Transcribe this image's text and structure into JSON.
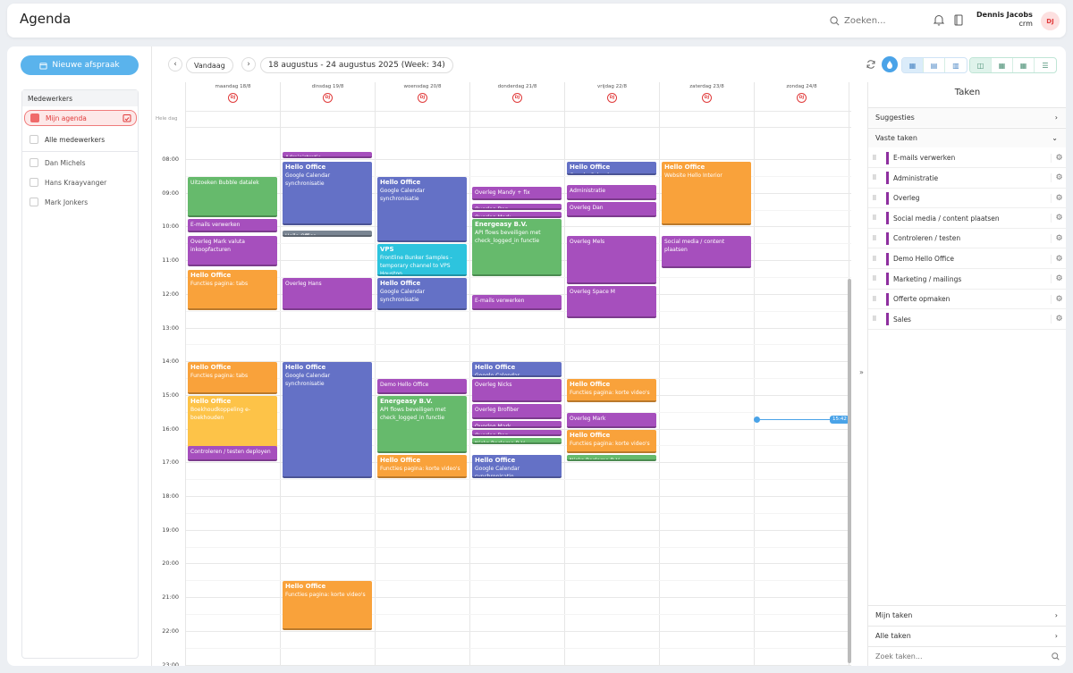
{
  "app": {
    "title": "Agenda"
  },
  "search": {
    "placeholder": "Zoeken..."
  },
  "user": {
    "name": "Dennis Jacobs",
    "role": "crm",
    "initials": "DJ"
  },
  "sidebar": {
    "new_button": "Nieuwe afspraak",
    "section_title": "Medewerkers",
    "items": [
      {
        "label": "Mijn agenda"
      },
      {
        "label": "Alle medewerkers"
      },
      {
        "label": "Dan Michels"
      },
      {
        "label": "Hans Kraayvanger"
      },
      {
        "label": "Mark Jonkers"
      }
    ]
  },
  "toolbar": {
    "prev": "‹",
    "next": "›",
    "today": "Vandaag",
    "range": "18 augustus - 24 augustus 2025 (Week: 34)"
  },
  "days": [
    {
      "label": "maandag 18/8",
      "initials": "DJ"
    },
    {
      "label": "dinsdag 19/8",
      "initials": "DJ"
    },
    {
      "label": "woensdag 20/8",
      "initials": "DJ"
    },
    {
      "label": "donderdag 21/8",
      "initials": "DJ"
    },
    {
      "label": "vrijdag 22/8",
      "initials": "DJ"
    },
    {
      "label": "zaterdag 23/8",
      "initials": "DJ"
    },
    {
      "label": "zondag 24/8",
      "initials": "DJ"
    }
  ],
  "allday_label": "Hele dag",
  "hours": [
    "08:00",
    "09:00",
    "10:00",
    "11:00",
    "12:00",
    "13:00",
    "14:00",
    "15:00",
    "16:00",
    "17:00",
    "18:00",
    "19:00",
    "20:00",
    "21:00",
    "22:00",
    "23:00"
  ],
  "now_label": "15:42",
  "events": [
    {
      "title": "",
      "text": "Administratie",
      "color": "purple"
    },
    {
      "title": "Hello Office",
      "text": "Google Calendar synchronisatie",
      "color": "blue"
    },
    {
      "title": "",
      "text": "Hello Office",
      "color": "grey"
    },
    {
      "title": "",
      "text": "Uitzoeken Bubble datalek",
      "color": "green"
    },
    {
      "title": "",
      "text": "E-mails verwerken",
      "color": "purple"
    },
    {
      "title": "",
      "text": "Overleg Mark valuta inkoopfacturen",
      "color": "purple"
    },
    {
      "title": "Hello Office",
      "text": "Functies pagina: tabs",
      "color": "orange"
    },
    {
      "title": "",
      "text": "Overleg Hans",
      "color": "purple"
    },
    {
      "title": "Hello Office",
      "text": "Google Calendar synchronisatie",
      "color": "blue"
    },
    {
      "title": "VPS",
      "text": "Frontline Bunker Samples - temporary channel to VPS Houston",
      "color": "teal"
    },
    {
      "title": "Hello Office",
      "text": "Google Calendar synchronisatie",
      "color": "blue"
    },
    {
      "title": "",
      "text": "Overleg Mandy + fix",
      "color": "purple"
    },
    {
      "title": "",
      "text": "Overleg Dan",
      "color": "purple"
    },
    {
      "title": "",
      "text": "Overleg Mark",
      "color": "purple"
    },
    {
      "title": "Energeasy B.V.",
      "text": "API flows beveiligen met check_logged_in functie",
      "color": "green"
    },
    {
      "title": "",
      "text": "E-mails verwerken",
      "color": "purple"
    },
    {
      "title": "Hello Office",
      "text": "Google Calendar",
      "color": "blue"
    },
    {
      "title": "",
      "text": "Administratie",
      "color": "purple"
    },
    {
      "title": "",
      "text": "Overleg Dan",
      "color": "purple"
    },
    {
      "title": "",
      "text": "Overleg Mels",
      "color": "purple"
    },
    {
      "title": "",
      "text": "Overleg Space M",
      "color": "purple"
    },
    {
      "title": "Hello Office",
      "text": "Website Hello Interior",
      "color": "orange"
    },
    {
      "title": "",
      "text": "Social media / content plaatsen",
      "color": "purple"
    },
    {
      "title": "Hello Office",
      "text": "Functies pagina: tabs",
      "color": "orange"
    },
    {
      "title": "Hello Office",
      "text": "Boekhoudkoppeling e-boekhouden",
      "color": "yellow"
    },
    {
      "title": "",
      "text": "Controleren / testen deployen",
      "color": "purple"
    },
    {
      "title": "Hello Office",
      "text": "Google Calendar synchronisatie",
      "color": "blue"
    },
    {
      "title": "",
      "text": "Demo Hello Office",
      "color": "purple"
    },
    {
      "title": "Energeasy B.V.",
      "text": "API flows beveiligen met check_logged_in functie",
      "color": "green"
    },
    {
      "title": "Hello Office",
      "text": "Functies pagina: korte video's",
      "color": "orange"
    },
    {
      "title": "Hello Office",
      "text": "Google Calendar",
      "color": "blue"
    },
    {
      "title": "",
      "text": "Overleg Nicks",
      "color": "purple"
    },
    {
      "title": "",
      "text": "Overleg Brofiber",
      "color": "purple"
    },
    {
      "title": "",
      "text": "Overleg Mark",
      "color": "purple"
    },
    {
      "title": "",
      "text": "Overleg Dan",
      "color": "purple"
    },
    {
      "title": "",
      "text": "Nicks Reclame B.V.",
      "color": "green"
    },
    {
      "title": "Hello Office",
      "text": "Google Calendar synchronisatie",
      "color": "blue"
    },
    {
      "title": "Hello Office",
      "text": "Functies pagina: korte video's",
      "color": "orange"
    },
    {
      "title": "",
      "text": "Overleg Mark",
      "color": "purple"
    },
    {
      "title": "Hello Office",
      "text": "Functies pagina: korte video's",
      "color": "orange"
    },
    {
      "title": "",
      "text": "Nicks Reclame B.V.",
      "color": "green"
    },
    {
      "title": "Hello Office",
      "text": "Functies pagina: korte video's",
      "color": "orange"
    }
  ],
  "taken": {
    "title": "Taken",
    "suggesties": "Suggesties",
    "vaste_taken": "Vaste taken",
    "items": [
      "E-mails verwerken",
      "Administratie",
      "Overleg",
      "Social media / content plaatsen",
      "Controleren / testen",
      "Demo Hello Office",
      "Marketing / mailings",
      "Offerte opmaken",
      "Sales"
    ],
    "mijn_taken": "Mijn taken",
    "alle_taken": "Alle taken",
    "search_placeholder": "Zoek taken..."
  },
  "colors": {
    "accent": "#5ab3ec",
    "purple": "#a64fbd",
    "blue": "#6471c6",
    "green": "#66ba6c",
    "orange": "#f9a23b",
    "yellow": "#fdc348",
    "teal": "#2dc4de",
    "red": "#e03a3a"
  }
}
